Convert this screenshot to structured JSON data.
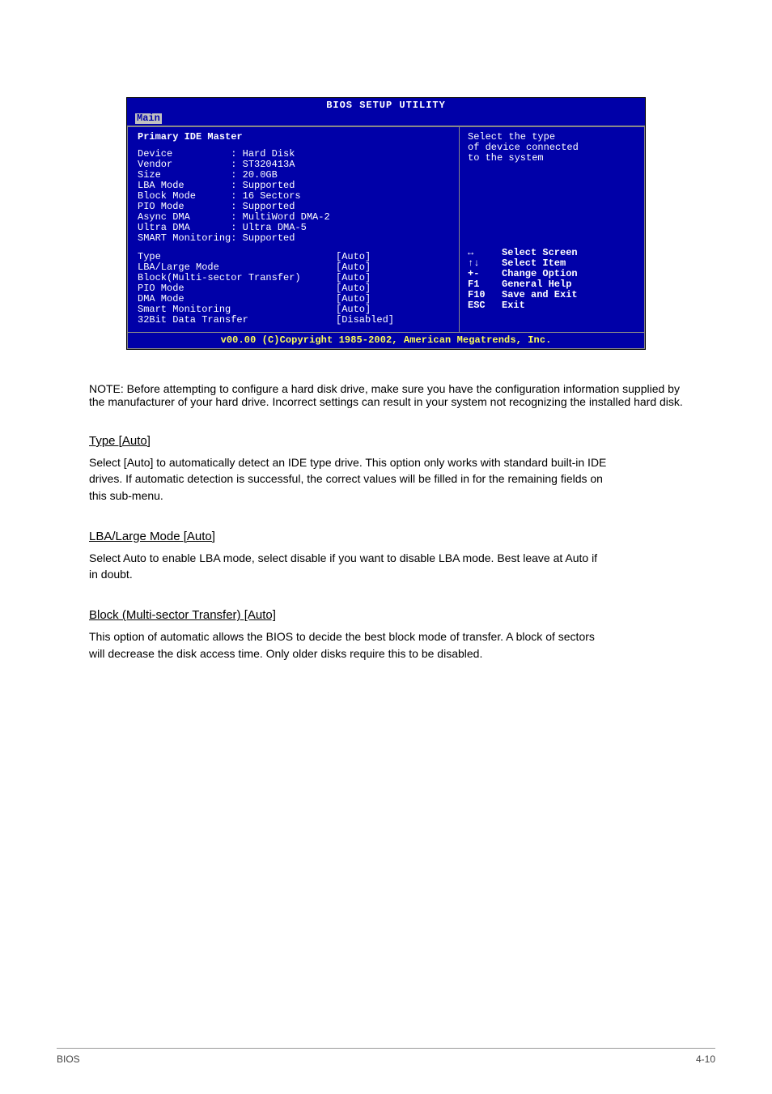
{
  "bios": {
    "title": "BIOS SETUP UTILITY",
    "tab": "Main",
    "leftHeading": "Primary IDE Master",
    "info": [
      {
        "label": "Device          ",
        "value": ": Hard Disk"
      },
      {
        "label": "Vendor          ",
        "value": ": ST320413A"
      },
      {
        "label": "Size            ",
        "value": ": 20.0GB"
      },
      {
        "label": "LBA Mode        ",
        "value": ": Supported"
      },
      {
        "label": "Block Mode      ",
        "value": ": 16 Sectors"
      },
      {
        "label": "PIO Mode        ",
        "value": ": Supported"
      },
      {
        "label": "Async DMA       ",
        "value": ": MultiWord DMA-2"
      },
      {
        "label": "Ultra DMA       ",
        "value": ": Ultra DMA-5"
      },
      {
        "label": "SMART Monitoring",
        "value": ": Supported"
      }
    ],
    "options": [
      {
        "label": "Type",
        "value": "[Auto]"
      },
      {
        "label": "LBA/Large Mode",
        "value": "[Auto]"
      },
      {
        "label": "Block(Multi-sector Transfer)",
        "value": "[Auto]"
      },
      {
        "label": "PIO Mode",
        "value": "[Auto]"
      },
      {
        "label": "DMA Mode",
        "value": "[Auto]"
      },
      {
        "label": "Smart Monitoring",
        "value": "[Auto]"
      },
      {
        "label": "32Bit Data Transfer",
        "value": "[Disabled]"
      }
    ],
    "helpText": "Select the type\nof device connected\nto the system",
    "nav": [
      {
        "key": "↔",
        "label": "Select Screen"
      },
      {
        "key": "↑↓",
        "label": "Select Item"
      },
      {
        "key": "+-",
        "label": "Change Option"
      },
      {
        "key": "F1",
        "label": "General Help"
      },
      {
        "key": "F10",
        "label": "Save and Exit"
      },
      {
        "key": "ESC",
        "label": "Exit"
      }
    ],
    "footer": "v00.00 (C)Copyright 1985-2002, American Megatrends, Inc."
  },
  "doc": {
    "note": "NOTE: Before attempting to configure a hard disk drive, make sure you have the configuration information supplied by the manufacturer of your hard drive. Incorrect settings can result in your system not recognizing the installed hard disk.",
    "sections": [
      {
        "h": "Type [Auto]",
        "p": "Select [Auto] to automatically detect an IDE type drive. This option only works with standard built-in IDE drives. If automatic detection is successful, the correct values will be filled in for the remaining fields on this sub-menu."
      },
      {
        "h": "LBA/Large Mode [Auto]",
        "p": "Select Auto to enable LBA mode, select disable if you want to disable LBA mode. Best leave at Auto if in doubt."
      },
      {
        "h": "Block (Multi-sector Transfer) [Auto]",
        "p": "This option of automatic allows the BIOS to decide the best block mode of transfer. A block of sectors will decrease the disk access time. Only older disks require this to be disabled."
      }
    ],
    "footerLeft": "BIOS",
    "footerRight": "4-10"
  }
}
